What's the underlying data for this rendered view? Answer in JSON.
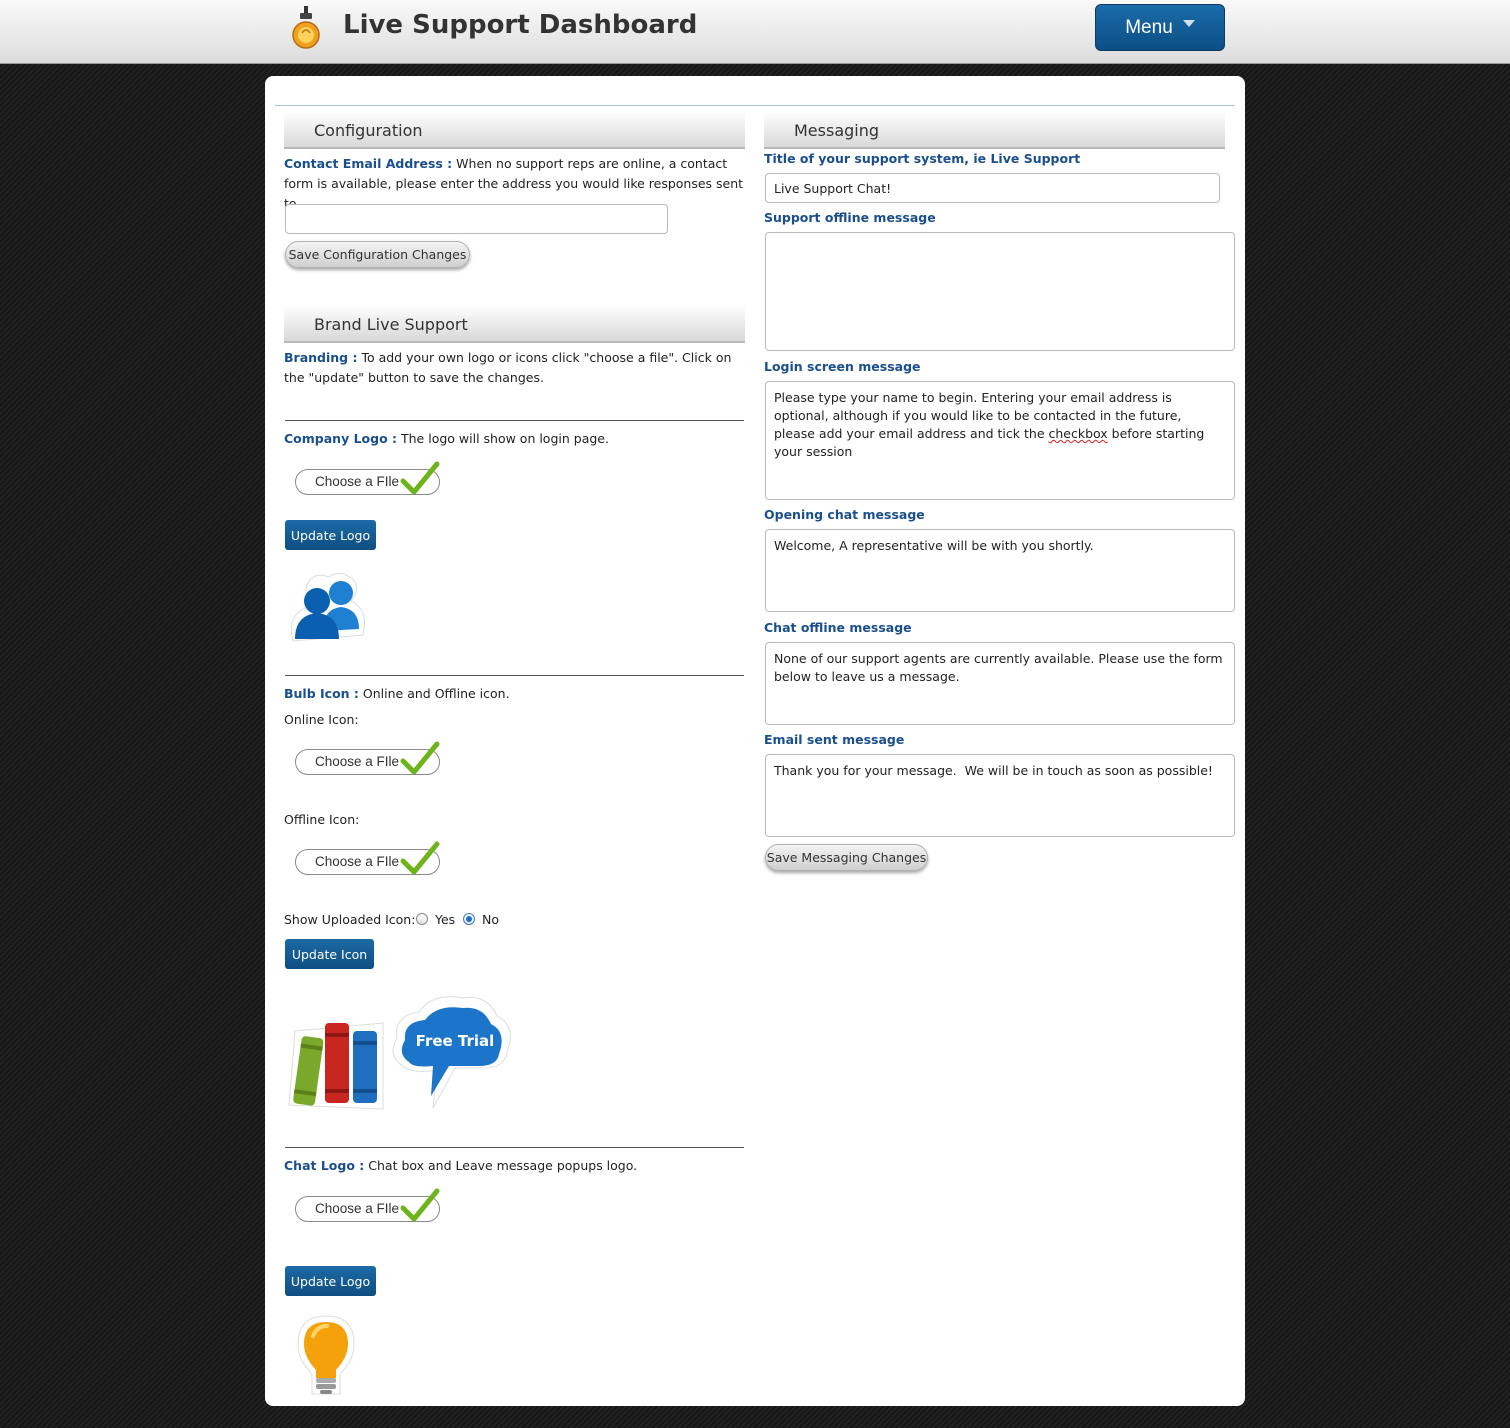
{
  "header": {
    "title": "Live Support Dashboard",
    "menu_label": "Menu"
  },
  "configuration": {
    "heading": "Configuration",
    "email_label": "Contact Email Address :",
    "email_desc": "When no support reps are online, a contact form is available, please enter the address you would like responses sent to.",
    "email_value": "",
    "save_label": "Save Configuration Changes"
  },
  "brand": {
    "heading": "Brand Live Support",
    "branding_label": "Branding :",
    "branding_desc": "To add your own logo or icons click \"choose a file\". Click on the \"update\" button to save the changes.",
    "company_logo_label": "Company Logo :",
    "company_logo_desc": "The logo will show on login page.",
    "choose_file_label": "Choose a FIle",
    "update_logo_label": "Update Logo",
    "bulb_icon_label": "Bulb Icon :",
    "bulb_icon_desc": "Online and Offline icon.",
    "online_icon_label": "Online Icon:",
    "offline_icon_label": "Offline Icon:",
    "show_uploaded_label": "Show Uploaded Icon:",
    "radio_yes": "Yes",
    "radio_no": "No",
    "show_uploaded_selected": "No",
    "update_icon_label": "Update Icon",
    "free_trial_text": "Free Trial",
    "chat_logo_label": "Chat Logo :",
    "chat_logo_desc": "Chat box and Leave message popups logo.",
    "update_chat_logo_label": "Update Logo"
  },
  "messaging": {
    "heading": "Messaging",
    "title_label": "Title of your support system, ie Live Support",
    "title_value": "Live Support Chat!",
    "support_offline_label": "Support offline message",
    "support_offline_value": "",
    "login_label": "Login screen message",
    "login_value_part1": "Please type your name to begin. Entering your email address is optional, although if you would like to be contacted in the future, please add your email address and tick the ",
    "login_value_spell": "checkbox",
    "login_value_part2": " before starting your session",
    "opening_label": "Opening chat message",
    "opening_value": "Welcome, A representative will be with you shortly.",
    "chat_offline_label": "Chat offline message",
    "chat_offline_value": "None of our support agents are currently available. Please use the form below to leave us a message.",
    "email_sent_label": "Email sent message",
    "email_sent_value": "Thank you for your message.  We will be in touch as soon as possible!",
    "save_label": "Save Messaging Changes"
  },
  "colors": {
    "accent_blue": "#0f4e82",
    "label_blue": "#1a4f8f",
    "checkmark_green": "#7cc21e"
  },
  "icons": [
    "bulb-icon",
    "checkmark-icon",
    "users-icon",
    "books-icon",
    "speech-cloud-icon",
    "lightbulb-icon",
    "caret-down-icon"
  ]
}
